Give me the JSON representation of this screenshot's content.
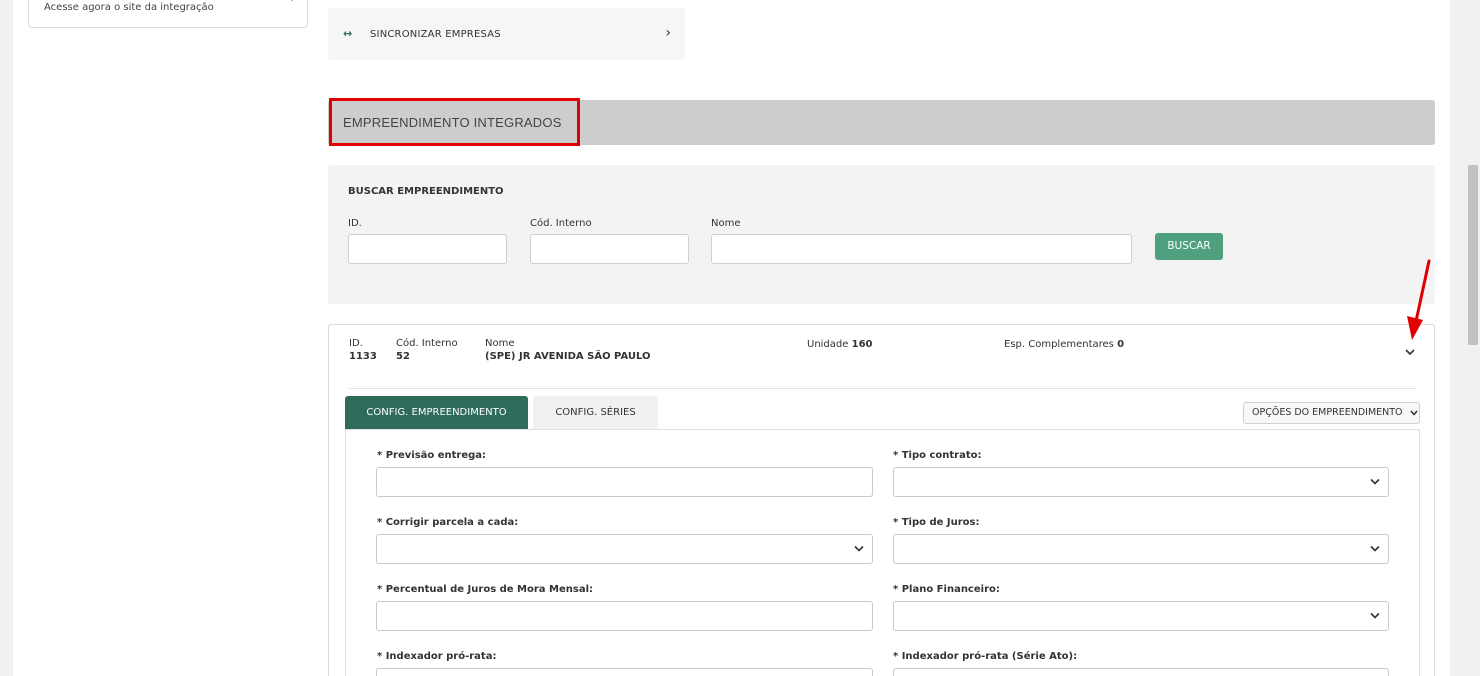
{
  "side_card": {
    "text": "Acesse agora o site da integração",
    "chevron": "›"
  },
  "sync": {
    "icon": "↔",
    "label": "SINCRONIZAR EMPRESAS",
    "chevron": "›"
  },
  "section": {
    "title": "EMPREENDIMENTO INTEGRADOS"
  },
  "search": {
    "title": "BUSCAR EMPREENDIMENTO",
    "id_label": "ID.",
    "cod_label": "Cód. Interno",
    "nome_label": "Nome",
    "button": "BUSCAR"
  },
  "result": {
    "id_label": "ID.",
    "id_value": "1133",
    "cod_label": "Cód. Interno",
    "cod_value": "52",
    "nome_label": "Nome",
    "nome_value": "(SPE) JR AVENIDA SÃO PAULO",
    "unidade_label": "Unidade",
    "unidade_value": "160",
    "esp_label": "Esp. Complementares",
    "esp_value": "0"
  },
  "tabs": {
    "config_emp": "CONFIG. EMPREENDIMENTO",
    "config_series": "CONFIG. SÉRIES"
  },
  "opcoes": {
    "label": "OPÇÕES DO EMPREENDIMENTO"
  },
  "form": {
    "previsao": "* Previsão entrega:",
    "tipo_contrato": "* Tipo contrato:",
    "corrigir": "* Corrigir parcela a cada:",
    "tipo_juros": "* Tipo de Juros:",
    "percentual": "* Percentual de Juros de Mora Mensal:",
    "plano": "* Plano Financeiro:",
    "indexador": "* Indexador pró-rata:",
    "indexador_ato": "* Indexador pró-rata (Série Ato):"
  },
  "colors": {
    "accent": "#2e6b5a",
    "button": "#4fa07f",
    "highlight": "#e00000"
  }
}
